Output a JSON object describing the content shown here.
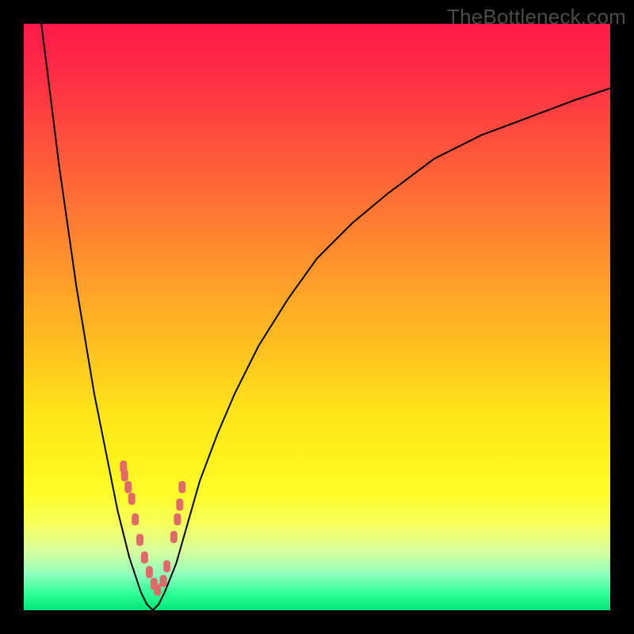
{
  "watermark": "TheBottleneck.com",
  "chart_data": {
    "type": "line",
    "title": "",
    "xlabel": "",
    "ylabel": "",
    "xlim": [
      0,
      100
    ],
    "ylim": [
      0,
      100
    ],
    "grid": false,
    "legend": null,
    "series": [
      {
        "name": "bottleneck-curve",
        "x": [
          3,
          4,
          5,
          6,
          7,
          8,
          9,
          10,
          11,
          12,
          13,
          14,
          15,
          16,
          17,
          18,
          19,
          20,
          21,
          22,
          23,
          24,
          26,
          28,
          30,
          33,
          36,
          40,
          45,
          50,
          56,
          62,
          70,
          78,
          86,
          94,
          100
        ],
        "y": [
          100,
          92,
          84,
          76,
          69,
          62,
          55,
          49,
          43,
          37,
          32,
          27,
          22,
          17,
          13,
          9,
          6,
          3,
          1,
          0,
          1,
          3,
          8,
          15,
          22,
          30,
          37,
          45,
          53,
          60,
          66,
          71,
          77,
          81,
          84,
          87,
          89
        ]
      }
    ],
    "markers": {
      "name": "highlight-points",
      "x": [
        17.0,
        17.2,
        17.8,
        18.4,
        19.0,
        19.8,
        20.6,
        21.4,
        22.2,
        22.8,
        23.8,
        24.4,
        25.6,
        26.2,
        26.6,
        27.0
      ],
      "y": [
        24.5,
        23.0,
        21.0,
        19.0,
        15.5,
        12.0,
        9.0,
        6.5,
        4.5,
        3.5,
        5.0,
        7.5,
        12.5,
        15.5,
        18.0,
        21.0
      ],
      "color": "#e06a6a",
      "size": 9
    },
    "background_gradient": {
      "top": "#ff1a4b",
      "mid": "#ffe41a",
      "bottom": "#00e676"
    }
  }
}
